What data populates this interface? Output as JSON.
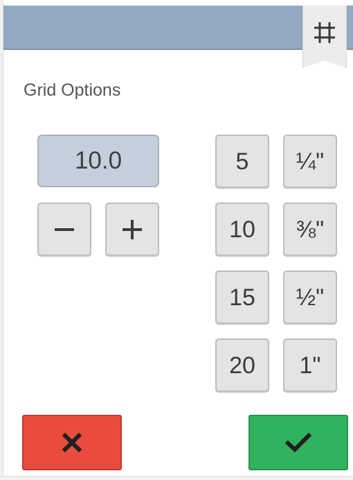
{
  "header": {
    "grid_tab_icon": "grid-icon"
  },
  "grid_options": {
    "title": "Grid Options",
    "value": "10.0",
    "decrement_icon": "minus-icon",
    "increment_icon": "plus-icon",
    "metric_presets": [
      "5",
      "10",
      "15",
      "20"
    ],
    "imperial_presets": [
      "¼\"",
      "⅜\"",
      "½\"",
      "1\""
    ]
  },
  "actions": {
    "cancel_icon": "x-icon",
    "confirm_icon": "checkmark-icon"
  },
  "colors": {
    "header_bar": "#94a9c1",
    "value_field": "#c5cfdc",
    "cancel": "#e94b3c",
    "confirm": "#2fb35e",
    "icon_dark": "#202020"
  }
}
